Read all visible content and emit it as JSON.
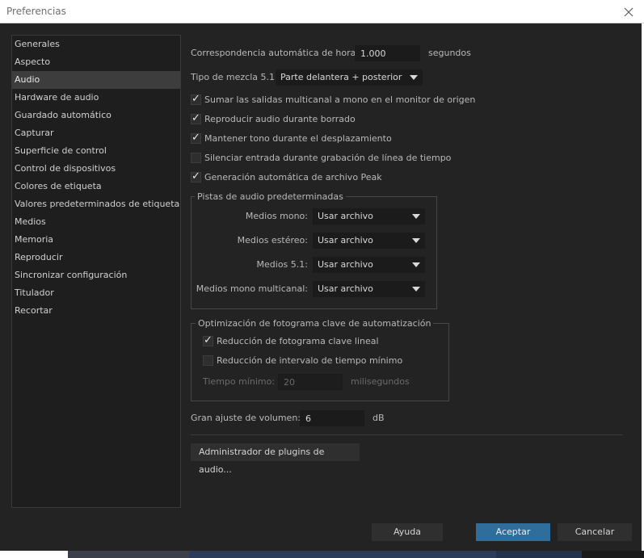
{
  "window": {
    "title": "Preferencias",
    "close_glyph": "✕"
  },
  "sidebar": {
    "items": [
      {
        "label": "Generales"
      },
      {
        "label": "Aspecto"
      },
      {
        "label": "Audio",
        "selected": true
      },
      {
        "label": "Hardware de audio"
      },
      {
        "label": "Guardado automático"
      },
      {
        "label": "Capturar"
      },
      {
        "label": "Superficie de control"
      },
      {
        "label": "Control de dispositivos"
      },
      {
        "label": "Colores de etiqueta"
      },
      {
        "label": "Valores predeterminados de etiqueta"
      },
      {
        "label": "Medios"
      },
      {
        "label": "Memoria"
      },
      {
        "label": "Reproducir"
      },
      {
        "label": "Sincronizar configuración"
      },
      {
        "label": "Titulador"
      },
      {
        "label": "Recortar"
      }
    ]
  },
  "audio": {
    "time_match": {
      "label": "Correspondencia automática de hora:",
      "value": "1.000",
      "unit": "segundos"
    },
    "mix_51": {
      "label": "Tipo de mezcla 5.1:",
      "value": "Parte delantera + posterior"
    },
    "checkboxes": [
      {
        "label": "Sumar las salidas multicanal a mono en el monitor de origen",
        "checked": true
      },
      {
        "label": "Reproducir audio durante borrado",
        "checked": true
      },
      {
        "label": "Mantener tono durante el desplazamiento",
        "checked": true
      },
      {
        "label": "Silenciar entrada durante grabación de línea de tiempo",
        "checked": false
      },
      {
        "label": "Generación automática de archivo Peak",
        "checked": true
      }
    ],
    "default_tracks": {
      "legend": "Pistas de audio predeterminadas",
      "rows": [
        {
          "label": "Medios mono:",
          "value": "Usar archivo"
        },
        {
          "label": "Medios estéreo:",
          "value": "Usar archivo"
        },
        {
          "label": "Medios 5.1:",
          "value": "Usar archivo"
        },
        {
          "label": "Medios mono multicanal:",
          "value": "Usar archivo"
        }
      ]
    },
    "keyframe_opt": {
      "legend": "Optimización de fotograma clave de automatización",
      "linear": {
        "label": "Reducción de fotograma clave lineal",
        "checked": true
      },
      "min_interval": {
        "label": "Reducción de intervalo de tiempo mínimo",
        "checked": false
      },
      "min_time": {
        "label": "Tiempo mínimo:",
        "value": "20",
        "unit": "milisegundos"
      }
    },
    "volume": {
      "label": "Gran ajuste de volumen:",
      "value": "6",
      "unit": "dB"
    },
    "plugin_manager_label": "Administrador de plugins de audio..."
  },
  "footer": {
    "help": "Ayuda",
    "ok": "Aceptar",
    "cancel": "Cancelar"
  },
  "colors": {
    "background": "#232323",
    "primary_button": "#2f6d9a",
    "selected_item": "#3d3d3d"
  },
  "icons": {
    "close": "close-icon",
    "check": "check-icon",
    "dropdown": "chevron-down-icon"
  }
}
